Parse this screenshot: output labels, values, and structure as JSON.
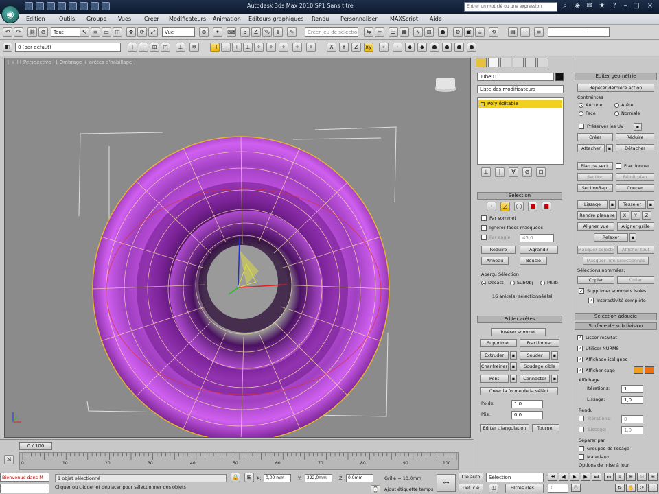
{
  "window": {
    "title": "Autodesk 3ds Max  2010 SP1        Sans titre",
    "search_placeholder": "Entrer un mot clé ou une expression"
  },
  "menubar": {
    "items": [
      "Edition",
      "Outils",
      "Groupe",
      "Vues",
      "Créer",
      "Modificateurs",
      "Animation",
      "Editeurs graphiques",
      "Rendu",
      "Personnaliser",
      "MAXScript",
      "Aide"
    ]
  },
  "toolbar": {
    "filter_value": "Tout",
    "coord_value": "Vue",
    "named_selection_placeholder": "Créer jeu de sélection",
    "layer_value": "0 (par défaut)",
    "axis_x": "X",
    "axis_y": "Y",
    "axis_z": "Z"
  },
  "viewport": {
    "label": "[ + ] [ Perspective ] [ Ombrage + arêtes d'habillage ]"
  },
  "command_panel": {
    "object_name": "Tube01",
    "modifier_list": "Liste des modificateurs",
    "stack_item": "Poly éditable",
    "selection": {
      "header": "Sélection",
      "by_vertex": "Par sommet",
      "ignore_back": "Ignorer faces masquées",
      "by_angle": "Par angle:",
      "angle_value": "45,0",
      "shrink": "Réduire",
      "grow": "Agrandir",
      "ring": "Anneau",
      "loop": "Boucle",
      "preview_label": "Aperçu Sélection",
      "preview_off": "Désact",
      "preview_subobj": "SubObj",
      "preview_multi": "Multi",
      "count": "16 arête(s) sélectionnée(s)"
    },
    "edit_edges": {
      "header": "Editer arêtes",
      "insert_vertex": "Insérer sommet",
      "remove": "Supprimer",
      "split": "Fractionner",
      "extrude": "Extruder",
      "weld": "Souder",
      "chamfer": "Chanfreiner",
      "target_weld": "Soudage cible",
      "bridge": "Pont",
      "connect": "Connecter",
      "create_shape": "Créer la forme de la séléct",
      "weight_label": "Poids:",
      "weight_value": "1,0",
      "crease_label": "Plis:",
      "crease_value": "0,0",
      "edit_tri": "Editer triangulation",
      "turn": "Tourner"
    }
  },
  "right_panel": {
    "edit_geometry": "Editer géométrie",
    "repeat_last": "Répéter dernière action",
    "constraints": "Contraintes",
    "c_none": "Aucune",
    "c_edge": "Arête",
    "c_face": "Face",
    "c_normal": "Normale",
    "preserve_uvs": "Préserver les UV",
    "create": "Créer",
    "collapse": "Réduire",
    "attach": "Attacher",
    "detach": "Détacher",
    "slice_plane": "Plan de sect.",
    "split": "Fractionner",
    "slice": "Section",
    "reset_plane": "Réinit plan",
    "quickslice": "SectionRap.",
    "cut": "Couper",
    "msmooth": "Lissage",
    "tessellate": "Tesseler",
    "make_planar": "Rendre planaire",
    "align_view": "Aligner vue",
    "align_grid": "Aligner grille",
    "relax": "Relaxer",
    "hide_sel": "Masquer sélection",
    "unhide_all": "Afficher tout",
    "hide_unsel": "Masquer non sélectionnés",
    "named_sel": "Sélections nommées:",
    "copy": "Copier",
    "paste": "Coller",
    "delete_iso": "Supprimer sommets isolés",
    "full_interactivity": "Interactivité complète",
    "soft_sel": "Sélection adoucie",
    "subdiv_surface": "Surface de subdivision",
    "smooth_result": "Lisser résultat",
    "use_nurms": "Utiliser NURMS",
    "show_cage": "Afficher cage",
    "isoline": "Affichage isolignes",
    "display_label": "Affichage",
    "iterations": "Itérations:",
    "iter_value": "1",
    "smoothness": "Lissage:",
    "smooth_value": "1,0",
    "render_label": "Rendu",
    "r_iterations": "Itérations:",
    "r_iter_value": "0",
    "r_smoothness": "Lissage:",
    "r_smooth_value": "1,0",
    "separate_by": "Séparer par",
    "smoothing_groups": "Groupes de lissage",
    "materials": "Matériaux",
    "update_options": "Options de mise à jour"
  },
  "timeline": {
    "slider_label": "0 / 100",
    "ticks": [
      "0",
      "10",
      "20",
      "30",
      "40",
      "50",
      "60",
      "70",
      "80",
      "90",
      "100"
    ]
  },
  "statusbar": {
    "listener": "Bienvenue dans M",
    "status": "1 objet sélectionné",
    "prompt": "Cliquer ou cliquer et déplacer pour sélectionner des objets",
    "x_label": "X:",
    "x_value": "0,00 mm",
    "y_label": "Y:",
    "y_value": "222,0mm",
    "z_label": "Z:",
    "z_value": "0,0mm",
    "grid": "Grille = 10,0mm",
    "add_time_tag": "Ajout étiquette temps",
    "auto_key": "Clé auto",
    "set_key": "Déf. clé",
    "selection_dropdown": "Sélection",
    "key_filters": "Filtres clés...",
    "frame_value": "0"
  },
  "colors": {
    "accent_yellow": "#f0d020",
    "torus": "#b040d0",
    "viewport_bg": "#8b8b8b"
  }
}
